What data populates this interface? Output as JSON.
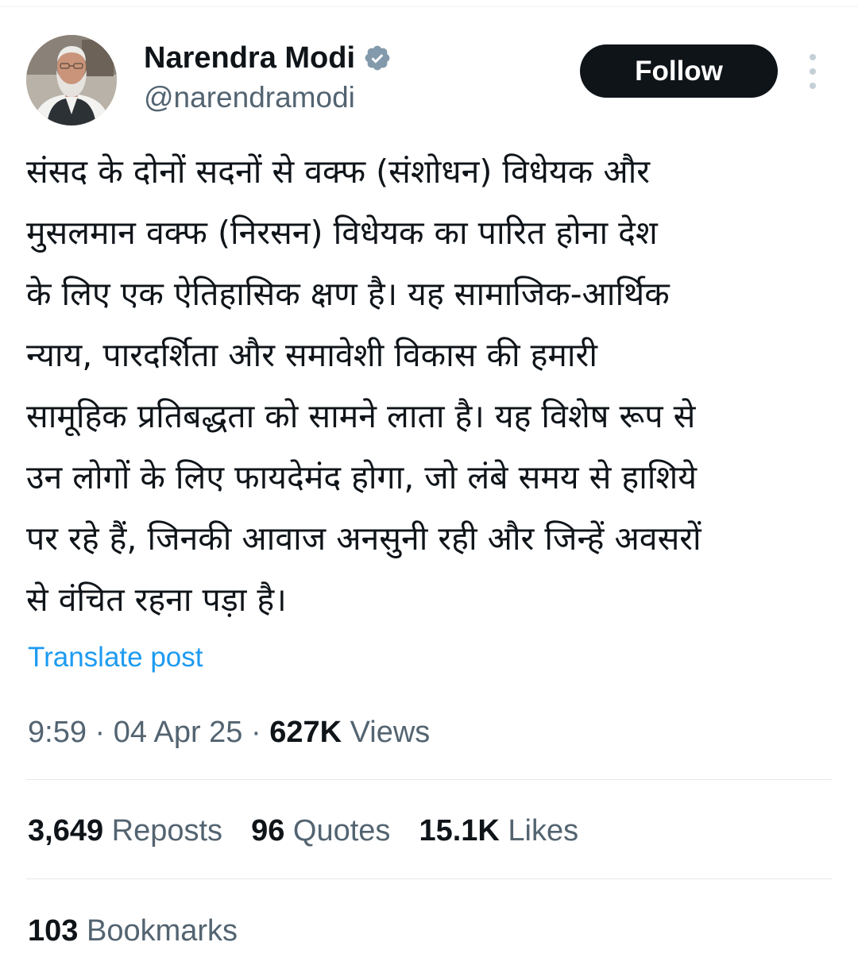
{
  "author": {
    "display_name": "Narendra Modi",
    "handle": "@narendramodi",
    "verified": true,
    "avatar": "profile-photo"
  },
  "actions": {
    "follow_label": "Follow",
    "more_icon": "more-vertical-icon"
  },
  "post": {
    "text": "संसद के दोनों सदनों से वक्फ (संशोधन) विधेयक और\nमुसलमान वक्फ (निरसन) विधेयक का पारित होना देश\nके लिए एक ऐतिहासिक क्षण है। यह सामाजिक-आर्थिक\nन्याय, पारदर्शिता और समावेशी विकास की हमारी\nसामूहिक प्रतिबद्धता को सामने लाता है। यह विशेष रूप से\nउन लोगों के लिए फायदेमंद होगा, जो लंबे समय से हाशिये\nपर रहे हैं, जिनकी आवाज अनसुनी रही और जिन्हें अवसरों\nसे वंचित रहना पड़ा है।",
    "translate_label": "Translate post"
  },
  "meta": {
    "time": "9:59",
    "separator": "·",
    "date": "04 Apr 25",
    "views_count": "627K",
    "views_label": "Views"
  },
  "stats": {
    "reposts_count": "3,649",
    "reposts_label": "Reposts",
    "quotes_count": "96",
    "quotes_label": "Quotes",
    "likes_count": "15.1K",
    "likes_label": "Likes",
    "bookmarks_count": "103",
    "bookmarks_label": "Bookmarks"
  },
  "colors": {
    "text_primary": "#0f1419",
    "text_secondary": "#536471",
    "link": "#1d9bf0",
    "verified_badge": "#829aab",
    "button_bg": "#0f1419"
  }
}
